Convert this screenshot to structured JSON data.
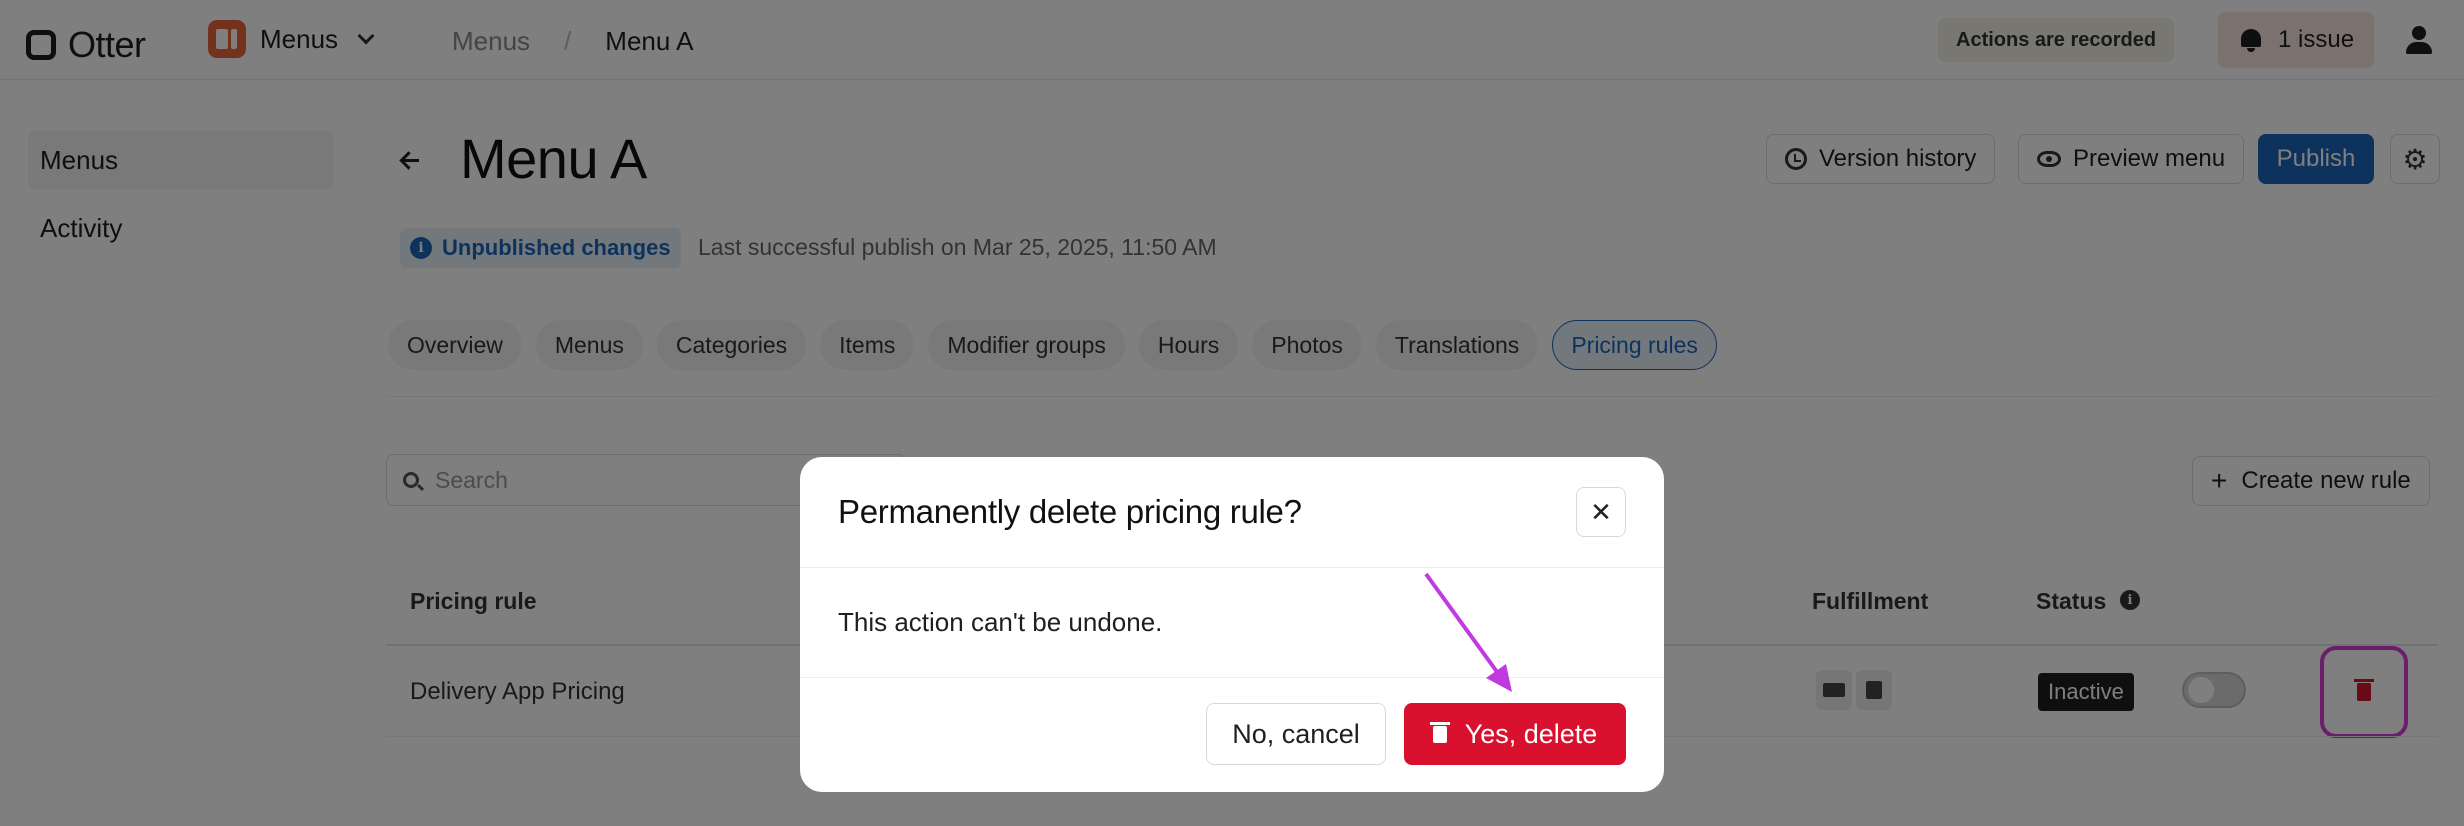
{
  "topbar": {
    "logo_text": "Otter",
    "app_label": "Menus",
    "breadcrumb": [
      "Menus",
      "/",
      "Menu A"
    ],
    "recorded_notice": "Actions are recorded",
    "issues_label": "1 issue"
  },
  "sidebar": {
    "items": [
      {
        "label": "Menus",
        "active": true
      },
      {
        "label": "Activity",
        "active": false
      }
    ]
  },
  "header": {
    "title": "Menu A",
    "version_history_label": "Version history",
    "preview_label": "Preview menu",
    "publish_label": "Publish",
    "unpublished_badge": "Unpublished changes",
    "last_publish": "Last successful publish on Mar 25, 2025, 11:50 AM"
  },
  "tabs": [
    {
      "label": "Overview"
    },
    {
      "label": "Menus"
    },
    {
      "label": "Categories"
    },
    {
      "label": "Items"
    },
    {
      "label": "Modifier groups"
    },
    {
      "label": "Hours"
    },
    {
      "label": "Photos"
    },
    {
      "label": "Translations"
    },
    {
      "label": "Pricing rules",
      "active": true
    }
  ],
  "table": {
    "search_placeholder": "Search",
    "create_label": "Create new rule",
    "headers": {
      "pricing_rule": "Pricing rule",
      "fulfillment": "Fulfillment",
      "status": "Status"
    },
    "rows": [
      {
        "name": "Delivery App Pricing",
        "status": "Inactive",
        "enabled": false
      }
    ]
  },
  "modal": {
    "title": "Permanently delete pricing rule?",
    "body": "This action can't be undone.",
    "cancel_label": "No, cancel",
    "delete_label": "Yes, delete",
    "close_glyph": "✕"
  },
  "colors": {
    "accent_blue": "#1a66b8",
    "danger_red": "#d9102e",
    "highlight_magenta": "#d83bd8"
  }
}
